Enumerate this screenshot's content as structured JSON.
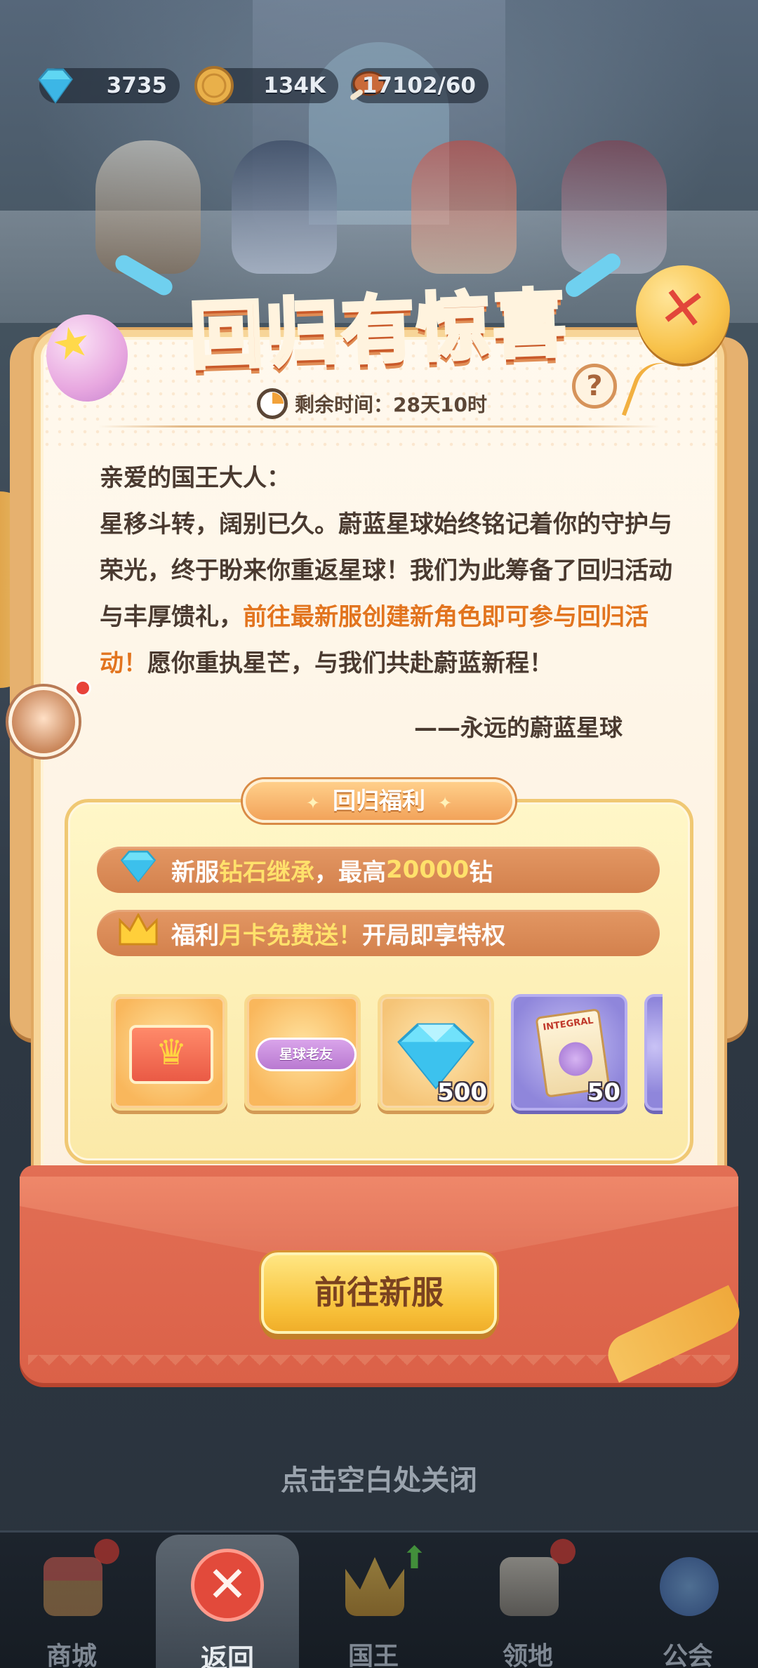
{
  "resources": {
    "diamond": {
      "icon": "diamond-icon",
      "value": "3735"
    },
    "gold": {
      "icon": "gold-coin-icon",
      "value": "134K"
    },
    "food": {
      "icon": "meat-icon",
      "value": "17102/60"
    }
  },
  "event": {
    "title": "回归有惊喜",
    "timer_label": "剩余时间：",
    "timer_value": "28天10时",
    "help_label": "?",
    "close_label": "✕"
  },
  "letter": {
    "greeting": "亲爱的国王大人：",
    "body_1": "星移斗转，阔别已久。蔚蓝星球始终铭记着你的守护与荣光，终于盼来你重返星球！我们为此筹备了回归活动与丰厚馈礼，",
    "body_highlight": "前往最新服创建新角色即可参与回归活动！",
    "body_2": "愿你重执星芒，与我们共赴蔚蓝新程！",
    "signature": "——永远的蔚蓝星球"
  },
  "benefits": {
    "tab_label": "回归福利",
    "perk_1": {
      "icon": "diamond-icon",
      "pre": "新服",
      "hl_1": "钻石继承",
      "mid": "，最高",
      "hl_2": "20000",
      "post": "钻"
    },
    "perk_2": {
      "icon": "crown-icon",
      "pre": "福利",
      "hl_1": "月卡免费送！",
      "post": "开局即享特权"
    },
    "items": [
      {
        "name": "monthly-card-icon",
        "qty": ""
      },
      {
        "name": "star-veteran-badge-icon",
        "label": "星球老友",
        "qty": ""
      },
      {
        "name": "diamond-icon",
        "qty": "500"
      },
      {
        "name": "integral-scroll-icon",
        "label": "INTEGRAL",
        "qty": "50"
      },
      {
        "name": "partial-item-icon",
        "qty": ""
      }
    ]
  },
  "go_button": "前往新服",
  "dismiss_hint": "点击空白处关闭",
  "nav": {
    "shop": "商城",
    "back": "返回",
    "king": "国王",
    "territory": "领地",
    "guild": "公会"
  },
  "colors": {
    "title": "#ff7a3c",
    "highlight": "#e2741e",
    "perk_highlight": "#ffe16b",
    "go_button": "#f8c23b",
    "envelope": "#db6148"
  }
}
